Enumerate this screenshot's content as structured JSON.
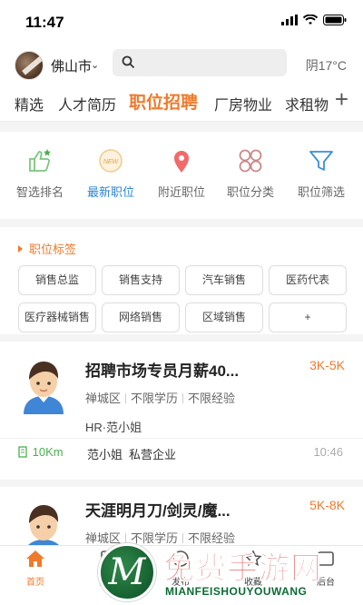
{
  "status_bar": {
    "time": "11:47"
  },
  "header": {
    "city": "佛山市",
    "weather": "阴17°C",
    "search_placeholder": ""
  },
  "tabs": [
    {
      "label": "精选",
      "active": false
    },
    {
      "label": "人才简历",
      "active": false
    },
    {
      "label": "职位招聘",
      "active": true
    },
    {
      "label": "厂房物业",
      "active": false
    },
    {
      "label": "求租物",
      "active": false
    }
  ],
  "tab_add_label": "+",
  "quick_nav": [
    {
      "label": "智选排名",
      "icon": "thumbs-up-icon",
      "active": false
    },
    {
      "label": "最新职位",
      "icon": "new-badge-icon",
      "active": true
    },
    {
      "label": "附近职位",
      "icon": "location-pin-icon",
      "active": false
    },
    {
      "label": "职位分类",
      "icon": "category-icon",
      "active": false
    },
    {
      "label": "职位筛选",
      "icon": "filter-icon",
      "active": false
    }
  ],
  "tags_title": "职位标签",
  "tags": [
    "销售总监",
    "销售支持",
    "汽车销售",
    "医药代表",
    "医疗器械销售",
    "网络销售",
    "区域销售",
    "+"
  ],
  "jobs": [
    {
      "title": "招聘市场专员月薪40...",
      "salary": "3K-5K",
      "district": "禅城区",
      "education": "不限学历",
      "experience": "不限经验",
      "hr": "HR·范小姐",
      "distance": "10Km",
      "contact": "范小姐",
      "company": "私营企业",
      "time": "10:46"
    },
    {
      "title": "天涯明月刀/剑灵/魔...",
      "salary": "5K-8K",
      "district": "禅城区",
      "education": "不限学历",
      "experience": "不限经验"
    }
  ],
  "bottom_nav": [
    {
      "label": "首页",
      "icon": "home-icon",
      "active": true
    },
    {
      "label": "简历",
      "icon": "resume-icon",
      "active": false
    },
    {
      "label": "发布",
      "icon": "publish-icon",
      "active": false
    },
    {
      "label": "收藏",
      "icon": "favorite-icon",
      "active": false
    },
    {
      "label": "后台",
      "icon": "backend-icon",
      "active": false
    }
  ],
  "watermark": {
    "logo_letter": "M",
    "title": "免费手游网",
    "subtitle": "MIANFEISHOUYOUWANG"
  },
  "colors": {
    "accent": "#f07a2c",
    "active_blue": "#2b86d6",
    "distance_green": "#4caf50"
  }
}
